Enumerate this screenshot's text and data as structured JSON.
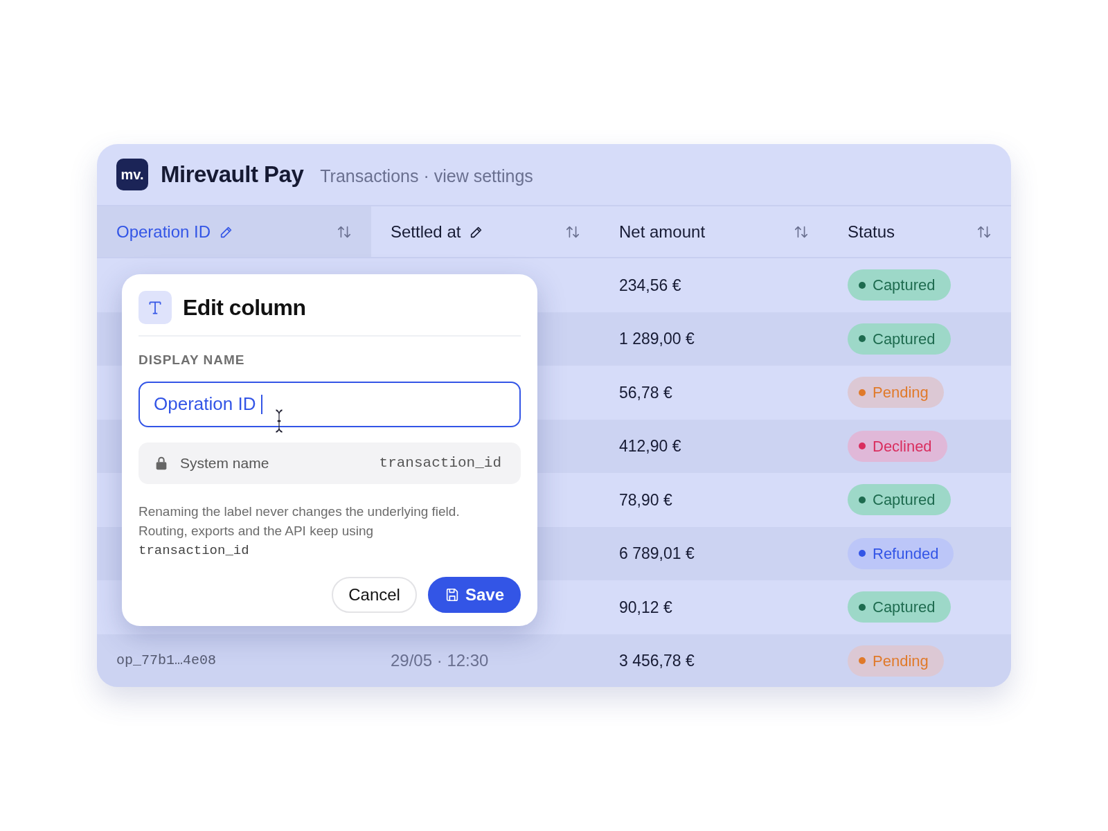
{
  "app": {
    "logo": "mv.",
    "name": "Mirevault Pay",
    "subtitle": "Transactions · view settings"
  },
  "table": {
    "columns": [
      {
        "label": "Operation ID",
        "editable": true,
        "selected": true
      },
      {
        "label": "Settled at",
        "editable": true,
        "selected": false
      },
      {
        "label": "Net amount",
        "editable": false,
        "selected": false
      },
      {
        "label": "Status",
        "editable": false,
        "selected": false
      }
    ],
    "rows": [
      {
        "net_amount": "234,56 €",
        "status": {
          "label": "Captured",
          "kind": "captured",
          "color": "#1e6b4f"
        }
      },
      {
        "net_amount": "1 289,00 €",
        "status": {
          "label": "Captured",
          "kind": "captured",
          "color": "#1e6b4f"
        }
      },
      {
        "net_amount": "56,78 €",
        "status": {
          "label": "Pending",
          "kind": "pending",
          "color": "#e07a2a"
        }
      },
      {
        "net_amount": "412,90 €",
        "status": {
          "label": "Declined",
          "kind": "declined",
          "color": "#d92d5e"
        }
      },
      {
        "net_amount": "78,90 €",
        "status": {
          "label": "Captured",
          "kind": "captured",
          "color": "#1e6b4f"
        }
      },
      {
        "net_amount": "6 789,01 €",
        "status": {
          "label": "Refunded",
          "kind": "refunded",
          "color": "#3355e6"
        }
      },
      {
        "net_amount": "90,12 €",
        "status": {
          "label": "Captured",
          "kind": "captured",
          "color": "#1e6b4f"
        }
      },
      {
        "operation_id": "op_77b1…4e08",
        "settled_at": "29/05 · 12:30",
        "net_amount": "3 456,78 €",
        "status": {
          "label": "Pending",
          "kind": "pending",
          "color": "#e07a2a"
        }
      }
    ]
  },
  "dialog": {
    "title": "Edit column",
    "field_label": "DISPLAY NAME",
    "display_name": "Operation ID ",
    "system_name_label": "System name",
    "system_name": "transaction_id",
    "note": "Renaming the label never changes the underlying field. Routing, exports and the API keep using",
    "note_code": "transaction_id",
    "buttons": [
      {
        "label": "Cancel",
        "kind": "secondary"
      },
      {
        "label": "Save",
        "kind": "primary"
      }
    ]
  }
}
